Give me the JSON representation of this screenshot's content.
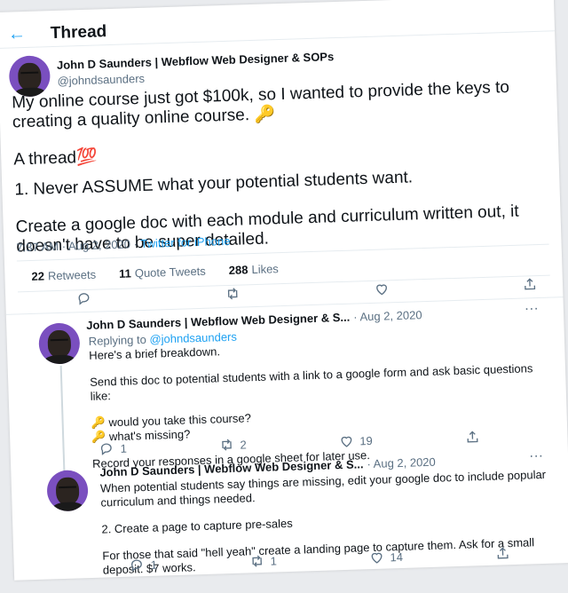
{
  "header": {
    "title": "Thread"
  },
  "main_tweet": {
    "author_name": "John D Saunders | Webflow Web Designer & SOPs",
    "handle": "@johndsaunders",
    "paragraph1": "My online course just got $100k, so I wanted to provide the keys to creating a quality online course. 🔑",
    "paragraph2": "A thread💯",
    "paragraph3": "1. Never ASSUME what your potential students want.",
    "paragraph4": "Create a google doc with each module and curriculum written out, it doesn't have to be super detailed.",
    "time": "7:37 AM · Aug 2, 2020 · ",
    "source": "Twitter for iPhone",
    "retweets": "22",
    "retweets_label": "Retweets",
    "quote_tweets": "11",
    "quote_tweets_label": "Quote Tweets",
    "likes": "288",
    "likes_label": "Likes"
  },
  "replies": [
    {
      "author": "John D Saunders | Webflow Web Designer & S...",
      "date": "· Aug 2, 2020",
      "replying_to_label": "Replying to",
      "replying_to_handle": "@johndsaunders",
      "p1": "Here's a brief breakdown.",
      "p2": "Send this doc to potential students with a link to a google form and ask basic questions like:",
      "bullet1": "🔑 would you take this course?",
      "bullet2": "🔑 what's missing?",
      "p3": "Record your responses in a google sheet for later use.",
      "replies": "1",
      "retweets": "2",
      "likes": "19"
    },
    {
      "author": "John D Saunders | Webflow Web Designer & S...",
      "date": "· Aug 2, 2020",
      "p1": "When potential students say things are missing, edit your google doc to include popular curriculum and things needed.",
      "p2": "2. Create a page to capture pre-sales",
      "p3": "For those that said \"hell yeah\" create a landing page to capture them. Ask for a small deposit. $7 works.",
      "replies": "1",
      "retweets": "1",
      "likes": "14"
    }
  ],
  "icons": {
    "back": "back-arrow-icon",
    "reply": "reply-icon",
    "retweet": "retweet-icon",
    "like": "heart-icon",
    "share": "share-icon",
    "more": "more-icon"
  },
  "colors": {
    "accent": "#1da1f2",
    "muted": "#5b7083",
    "avatar_bg": "#7a4fbf"
  }
}
